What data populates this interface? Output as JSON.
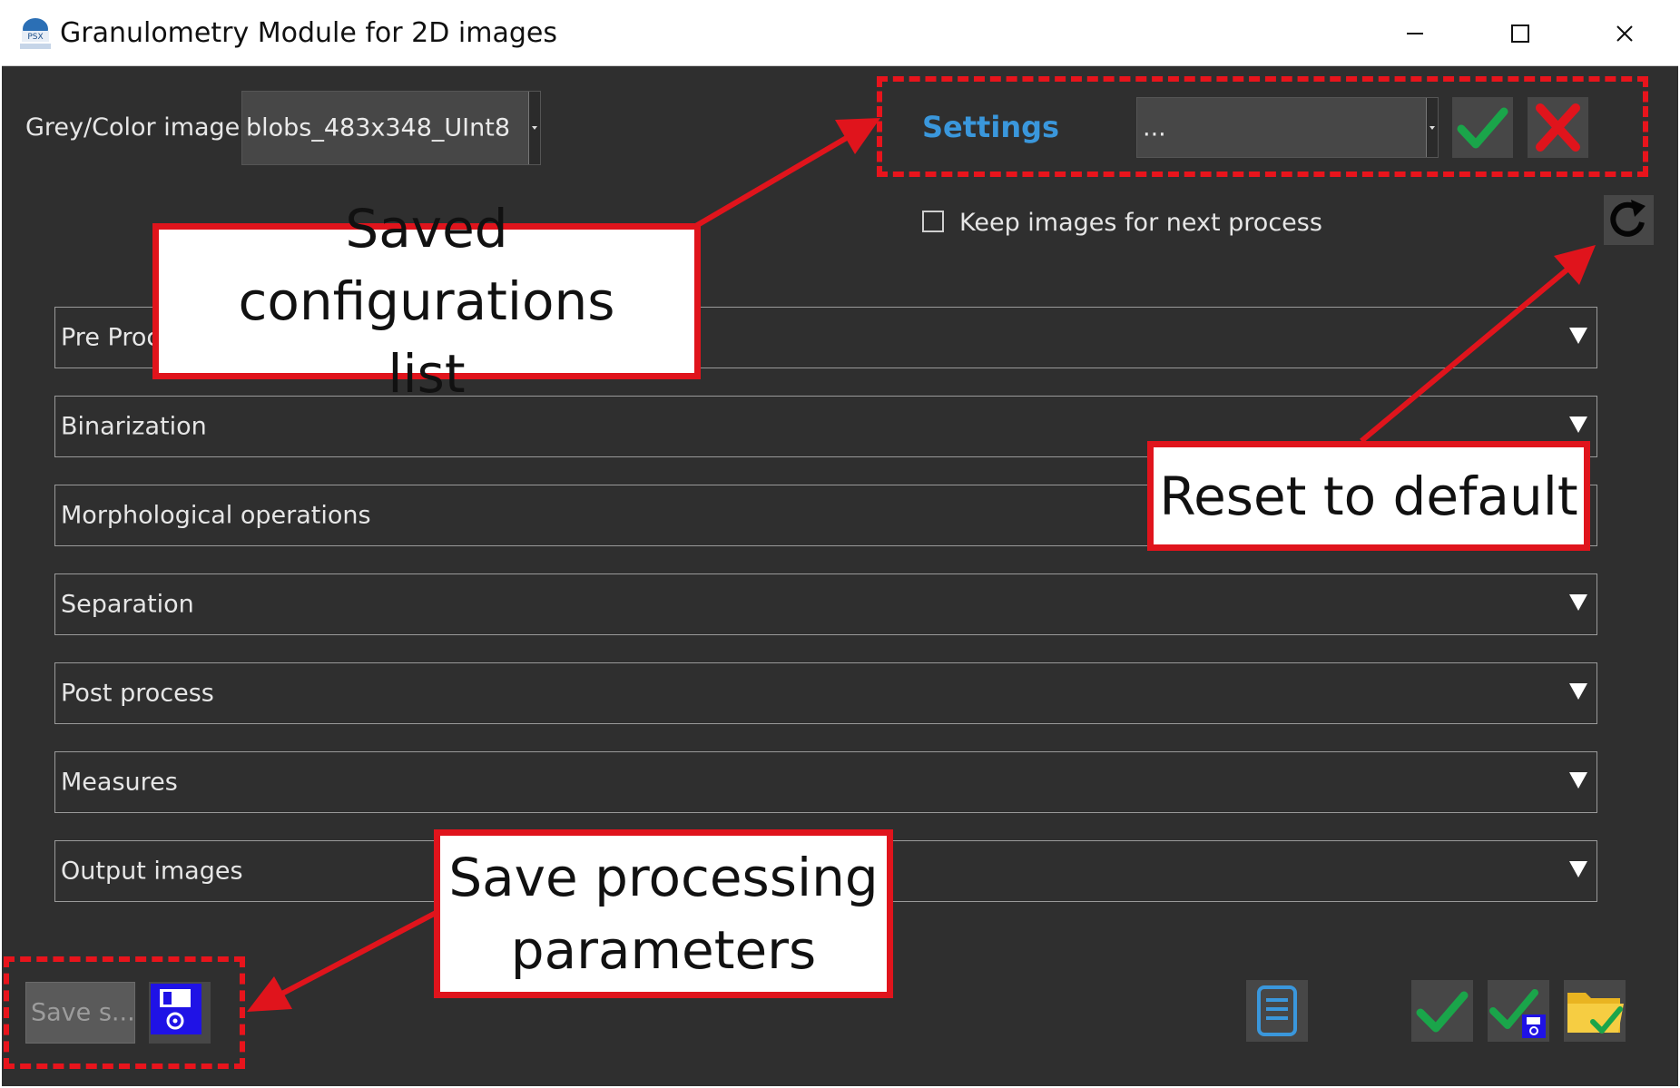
{
  "window": {
    "title": "Granulometry Module for 2D images",
    "app_icon": "app-logo-icon",
    "controls": [
      "minimize-icon",
      "maximize-icon",
      "close-icon"
    ]
  },
  "image_selector": {
    "label": "Grey/Color image",
    "value": "blobs_483x348_UInt8"
  },
  "settings": {
    "label": "Settings",
    "value": "...",
    "apply_icon": "checkmark-icon",
    "delete_icon": "red-x-icon"
  },
  "keep_images": {
    "label": "Keep images for next process",
    "checked": false
  },
  "reset_icon": "reset-icon",
  "sections": [
    {
      "label": "Pre Proc"
    },
    {
      "label": "Binarization"
    },
    {
      "label": "Morphological operations"
    },
    {
      "label": "Separation"
    },
    {
      "label": "Post process"
    },
    {
      "label": "Measures"
    },
    {
      "label": "Output images"
    }
  ],
  "save_panel": {
    "input_value": "Save s...",
    "save_icon": "floppy-disk-icon"
  },
  "bottom_toolbar": {
    "icons": [
      "document-list-icon",
      "checkmark-icon",
      "check-save-icon",
      "folder-check-icon"
    ]
  },
  "callouts": {
    "saved_configs": [
      "Saved configurations",
      "list"
    ],
    "reset_default": "Reset to default",
    "save_params": [
      "Save processing",
      "parameters"
    ]
  },
  "colors": {
    "background": "#2f2f2f",
    "accent_blue": "#3a97dc",
    "annotation_red": "#e0141c",
    "check_green": "#1aa54a"
  }
}
